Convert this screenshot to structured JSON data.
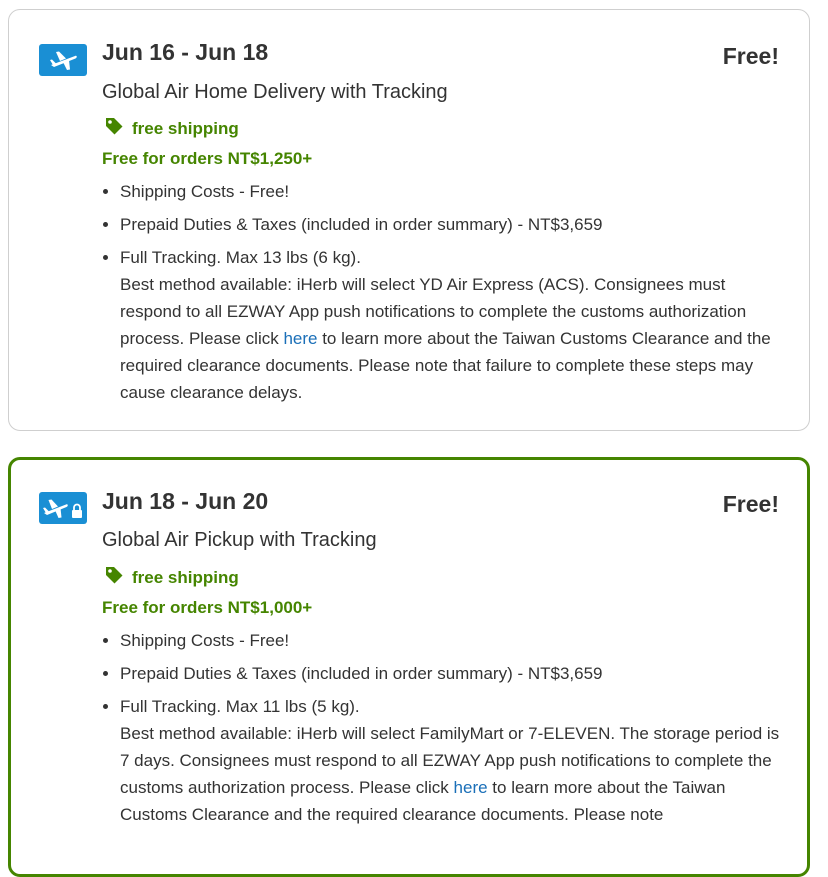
{
  "options": [
    {
      "date_range": "Jun 16 - Jun 18",
      "price": "Free!",
      "method": "Global Air Home Delivery with Tracking",
      "tag_label": "free shipping",
      "free_threshold": "Free for orders NT$1,250+",
      "shipping_costs": "Shipping Costs - Free!",
      "duties": "Prepaid Duties & Taxes (included in order summary) - NT$3,659",
      "tracking_line": "Full Tracking. Max 13 lbs (6 kg).",
      "desc_before": "Best method available: iHerb will select YD Air Express (ACS). Consignees must respond to all EZWAY App push notifications to complete the customs authorization process. Please click ",
      "link_text": "here",
      "desc_after": " to learn more about the Taiwan Customs Clearance and the required clearance documents. Please note that failure to complete these steps may cause clearance delays.",
      "icon": "airplane-icon",
      "selected": false
    },
    {
      "date_range": "Jun 18 - Jun 20",
      "price": "Free!",
      "method": "Global Air Pickup with Tracking",
      "tag_label": "free shipping",
      "free_threshold": "Free for orders NT$1,000+",
      "shipping_costs": "Shipping Costs - Free!",
      "duties": "Prepaid Duties & Taxes (included in order summary) - NT$3,659",
      "tracking_line": "Full Tracking. Max 11 lbs (5 kg).",
      "desc_before": "Best method available: iHerb will select FamilyMart or 7-ELEVEN. The storage period is 7 days. Consignees must respond to all EZWAY App push notifications to complete the customs authorization process. Please click ",
      "link_text": "here",
      "desc_after": " to learn more about the Taiwan Customs Clearance and the required clearance documents. Please note",
      "icon": "airplane-lock-icon",
      "selected": true
    }
  ],
  "colors": {
    "accent_green": "#458500",
    "icon_blue": "#1a8fd4",
    "link_blue": "#1a6fb8",
    "border_gray": "#cfcfcf"
  }
}
